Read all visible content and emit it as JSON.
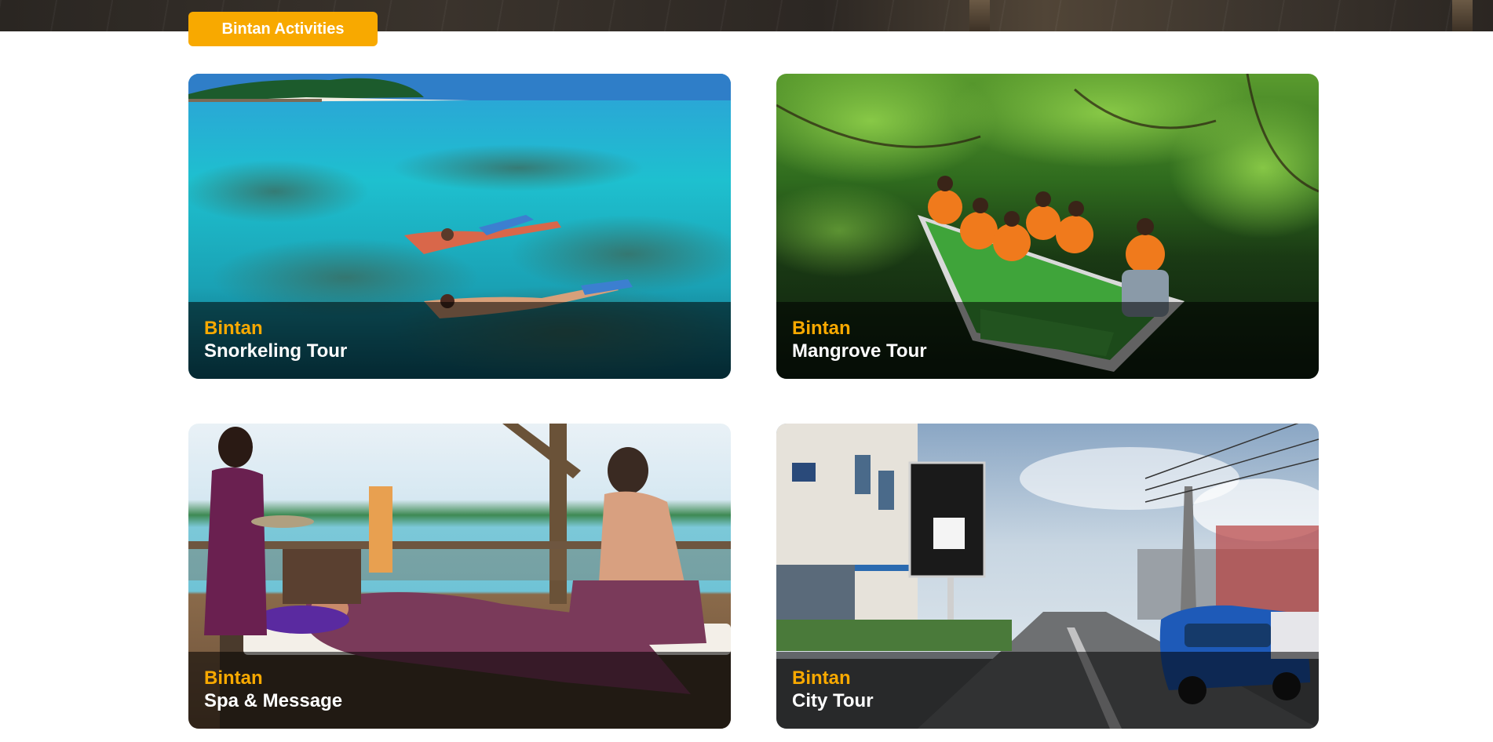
{
  "section": {
    "button_label": "Bintan Activities"
  },
  "colors": {
    "accent": "#f8a900",
    "caption_overlay": "rgba(0,0,0,0.55)",
    "title_text": "#ffffff"
  },
  "activities": [
    {
      "place": "Bintan",
      "title": "Snorkeling Tour",
      "image": "snorkeling-photo"
    },
    {
      "place": "Bintan",
      "title": "Mangrove Tour",
      "image": "mangrove-boat-photo"
    },
    {
      "place": "Bintan",
      "title": "Spa & Message",
      "image": "beach-spa-photo"
    },
    {
      "place": "Bintan",
      "title": "City Tour",
      "image": "city-street-photo"
    }
  ]
}
